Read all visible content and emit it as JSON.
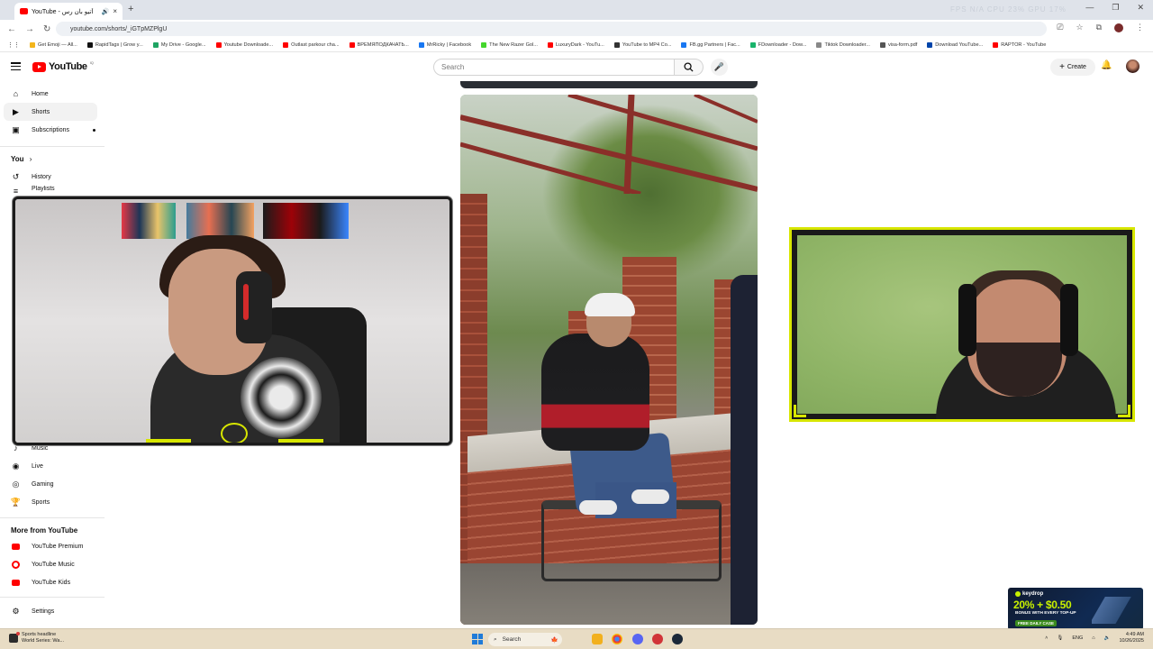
{
  "browser": {
    "tab_title": "YouTube - آتیو بان رس",
    "tab_close": "×",
    "new_tab": "+",
    "window_controls": [
      "—",
      "❐",
      "✕"
    ],
    "url": "youtube.com/shorts/_iGTpMZPlgU",
    "faded_stats": "FPS N/A   CPU 23%   GPU 17%",
    "bookmarks": [
      {
        "label": "Get Emoji — All...",
        "color": "#f3b51b"
      },
      {
        "label": "RapidTags | Grow y...",
        "color": "#111111"
      },
      {
        "label": "My Drive - Google...",
        "color": "#1fa463"
      },
      {
        "label": "Youtube Downloade...",
        "color": "#ff0000"
      },
      {
        "label": "Outlast parkour cha...",
        "color": "#ff0000"
      },
      {
        "label": "ВРЕМЯПОДКАЧАТЬ...",
        "color": "#ff0000"
      },
      {
        "label": "MrRicky | Facebook",
        "color": "#1877f2"
      },
      {
        "label": "The New Razer Gol...",
        "color": "#44d62c"
      },
      {
        "label": "LuxuryDark - YouTu...",
        "color": "#ff0000"
      },
      {
        "label": "YouTube to MP4 Co...",
        "color": "#333333"
      },
      {
        "label": "FB.gg Partners | Fac...",
        "color": "#1877f2"
      },
      {
        "label": "FDownloader - Dow...",
        "color": "#19b36b"
      },
      {
        "label": "Tiktok Downloader...",
        "color": "#888888"
      },
      {
        "label": "visa-form.pdf",
        "color": "#555555"
      },
      {
        "label": "Download YouTube...",
        "color": "#0044aa"
      },
      {
        "label": "RAPTOR - YouTube",
        "color": "#ff0000"
      }
    ]
  },
  "youtube": {
    "logo_text": "YouTube",
    "logo_region": "IQ",
    "search_placeholder": "Search",
    "create_label": "Create",
    "sidebar": {
      "main": [
        {
          "label": "Home",
          "icon": "⌂"
        },
        {
          "label": "Shorts",
          "icon": "▶"
        },
        {
          "label": "Subscriptions",
          "icon": "▣"
        }
      ],
      "you_header": "You",
      "you_items": [
        {
          "label": "History",
          "icon": "↺"
        },
        {
          "label": "Playlists",
          "icon": "≡"
        }
      ],
      "explore_items": [
        {
          "label": "Music",
          "icon": "♪"
        },
        {
          "label": "Live",
          "icon": "◉"
        },
        {
          "label": "Gaming",
          "icon": "◎"
        },
        {
          "label": "Sports",
          "icon": "🏆"
        }
      ],
      "more_header": "More from YouTube",
      "more_items": [
        {
          "label": "YouTube Premium",
          "color": "#ff0000"
        },
        {
          "label": "YouTube Music",
          "color": "#ff0000"
        },
        {
          "label": "YouTube Kids",
          "color": "#ff0000"
        }
      ],
      "settings_label": "Settings"
    }
  },
  "ad": {
    "brand": "keydrop",
    "amount": "20% + $0.50",
    "subtitle": "BONUS WITH EVERY TOP-UP",
    "badge": "FREE DAILY CASE"
  },
  "taskbar": {
    "weather_line1": "Sports headline",
    "weather_line2": "World Series: Wa...",
    "search_label": "Search",
    "lang": "ENG",
    "time": "4:49 AM",
    "date": "10/26/2025"
  },
  "colors": {
    "youtube_red": "#ff0000",
    "overlay_accent": "#d7e600",
    "taskbar_bg": "#e8dcc4"
  }
}
